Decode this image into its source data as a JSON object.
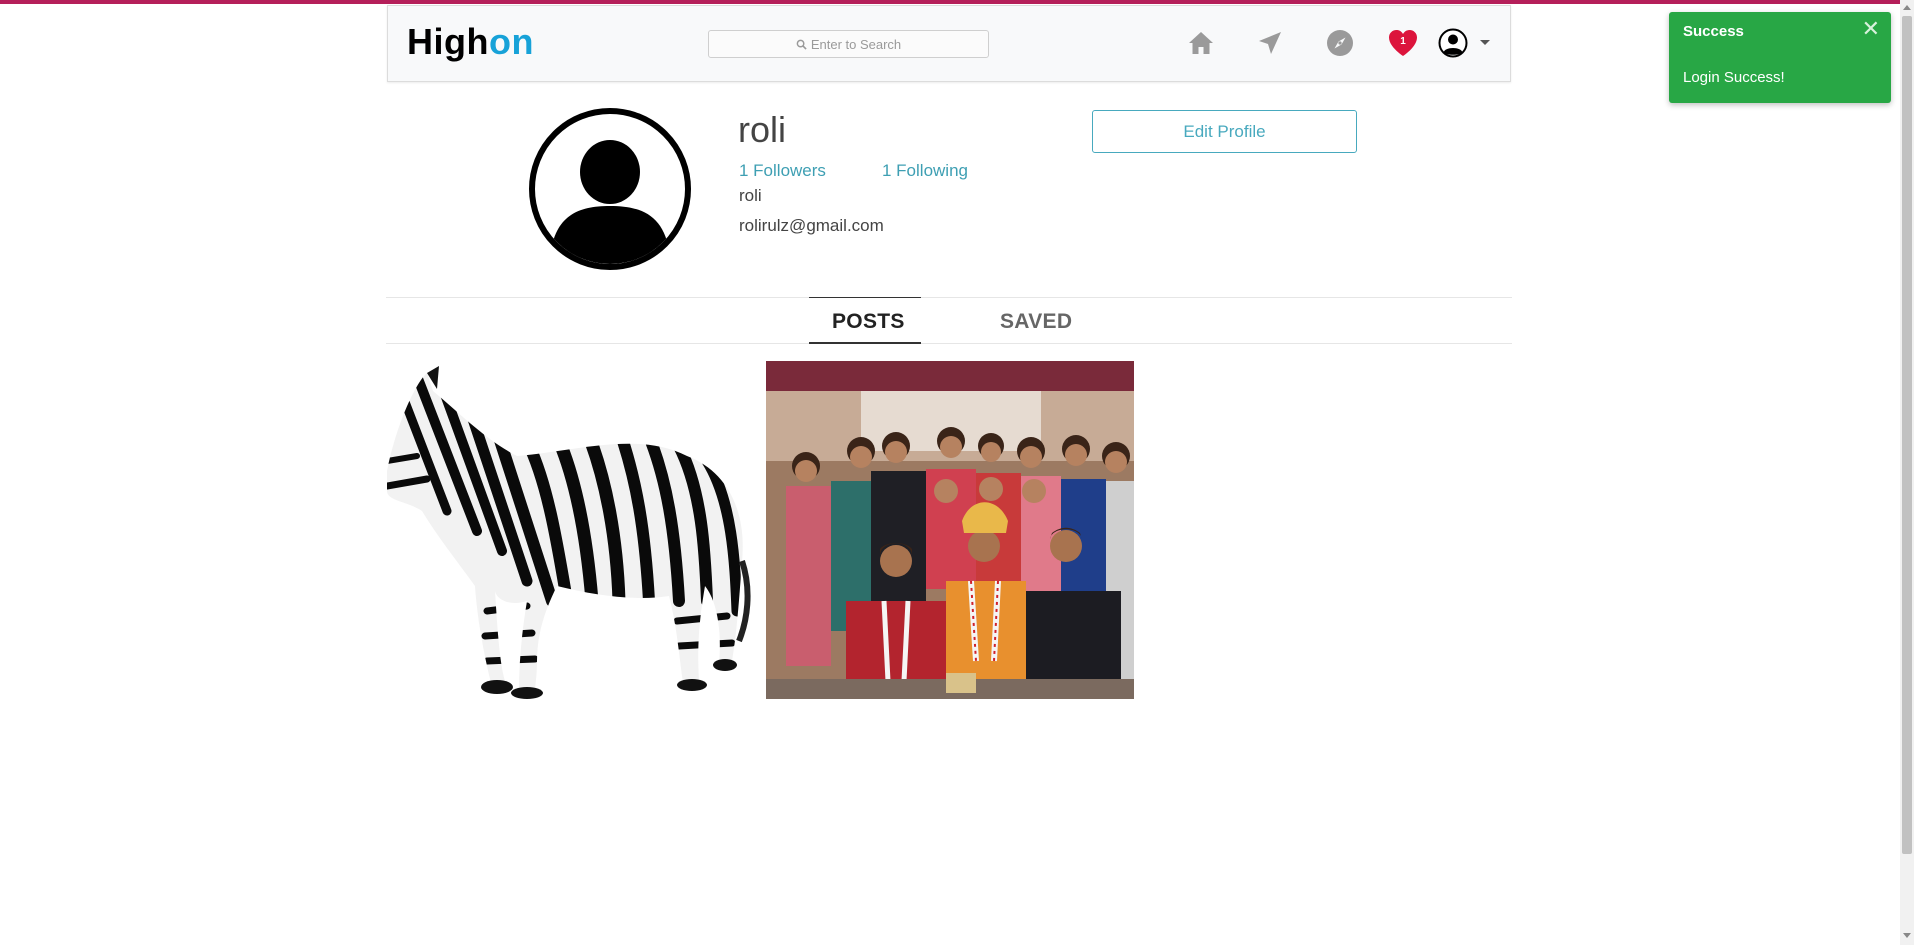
{
  "navbar": {
    "brand_part1": "High",
    "brand_part2": "on",
    "search_placeholder": "Enter to Search",
    "icons": [
      "home-icon",
      "send-icon",
      "explore-icon",
      "heart-icon",
      "user-avatar-icon"
    ],
    "notification_count": "1"
  },
  "toast": {
    "title": "Success",
    "message": "Login Success!",
    "close_symbol": "✕",
    "color": "#28a745"
  },
  "profile": {
    "username": "roli",
    "followers": "1 Followers",
    "following": "1 Following",
    "full_name": "roli",
    "email": "rolirulz@gmail.com",
    "edit_button": "Edit Profile"
  },
  "tabs": {
    "posts": "POSTS",
    "saved": "SAVED"
  },
  "posts": [
    {
      "subject": "zebra"
    },
    {
      "subject": "wedding-group-photo"
    }
  ],
  "colors": {
    "top_accent": "#b51f5a",
    "brand_blue": "#17a2d8",
    "link_teal": "#3e9fb3",
    "heart_red": "#dc143c"
  }
}
